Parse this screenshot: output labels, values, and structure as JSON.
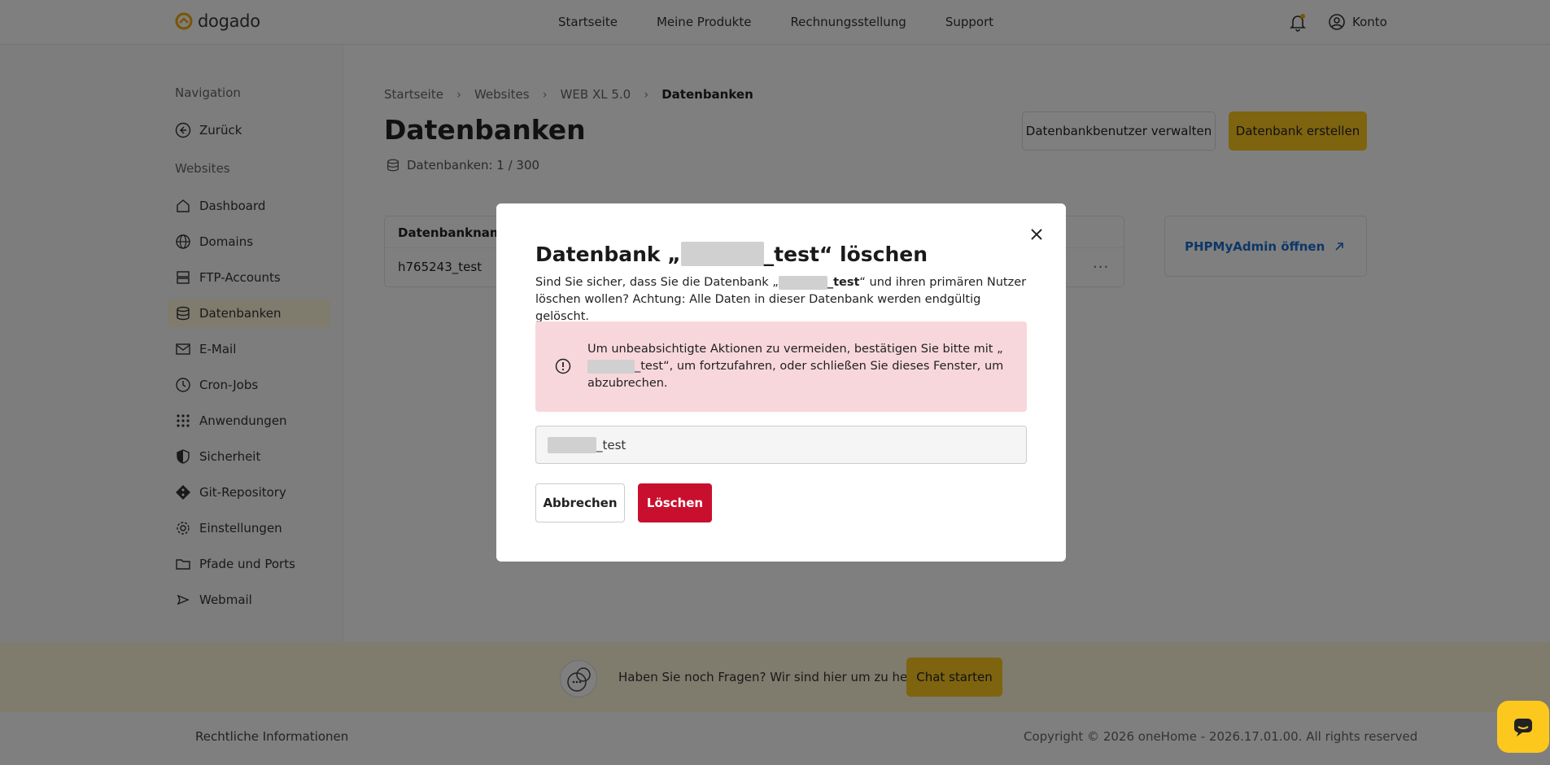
{
  "header": {
    "logo_text": "dogado",
    "nav": [
      "Startseite",
      "Meine Produkte",
      "Rechnungsstellung",
      "Support"
    ],
    "account_label": "Konto"
  },
  "sidebar": {
    "section_navigation": "Navigation",
    "back_label": "Zurück",
    "section_websites": "Websites",
    "items": [
      {
        "label": "Dashboard",
        "icon": "home-icon"
      },
      {
        "label": "Domains",
        "icon": "globe-icon"
      },
      {
        "label": "FTP-Accounts",
        "icon": "server-icon"
      },
      {
        "label": "Datenbanken",
        "icon": "database-icon",
        "active": true
      },
      {
        "label": "E-Mail",
        "icon": "mail-icon"
      },
      {
        "label": "Cron-Jobs",
        "icon": "clock-icon"
      },
      {
        "label": "Anwendungen",
        "icon": "grid-icon"
      },
      {
        "label": "Sicherheit",
        "icon": "shield-icon"
      },
      {
        "label": "Git-Repository",
        "icon": "git-icon"
      },
      {
        "label": "Einstellungen",
        "icon": "gear-icon"
      },
      {
        "label": "Pfade und Ports",
        "icon": "folder-icon"
      },
      {
        "label": "Webmail",
        "icon": "send-icon"
      }
    ]
  },
  "main": {
    "breadcrumb": [
      "Startseite",
      "Websites",
      "WEB XL 5.0",
      "Datenbanken"
    ],
    "title": "Datenbanken",
    "db_count": "Datenbanken: 1 / 300",
    "manage_users_label": "Datenbankbenutzer verwalten",
    "create_db_label": "Datenbank erstellen",
    "table": {
      "header": "Datenbankname",
      "rows": [
        "h765243_test"
      ],
      "more_label": "···"
    },
    "phpmyadmin_label": "PHPMyAdmin öffnen"
  },
  "help": {
    "text": "Haben Sie noch Fragen? Wir sind hier um zu helfen.",
    "chat_label": "Chat starten"
  },
  "footer": {
    "left": "Rechtliche Informationen",
    "right": "Copyright © 2026 oneHome - 2026.17.01.00. All rights reserved"
  },
  "modal": {
    "title_prefix": "Datenbank „",
    "title_suffix": "_test“ löschen",
    "desc_part1": "Sind Sie sicher, dass Sie die Datenbank „",
    "desc_db": "_test",
    "desc_part2": "“ und ihren primären Nutzer löschen wollen? Achtung: Alle Daten in dieser Datenbank werden endgültig gelöscht.",
    "warning_part1": "Um unbeabsichtigte Aktionen zu vermeiden, bestätigen Sie bitte mit „",
    "warning_part2": "_test“, um fortzufahren, oder schließen Sie dieses Fenster, um abzubrechen.",
    "input_value": "_test",
    "cancel_label": "Abbrechen",
    "delete_label": "Löschen"
  },
  "colors": {
    "accent_yellow": "#fcc81e",
    "danger_red": "#c8102e",
    "warning_bg": "#f8d7dc",
    "link_blue": "#1b6ed1"
  }
}
